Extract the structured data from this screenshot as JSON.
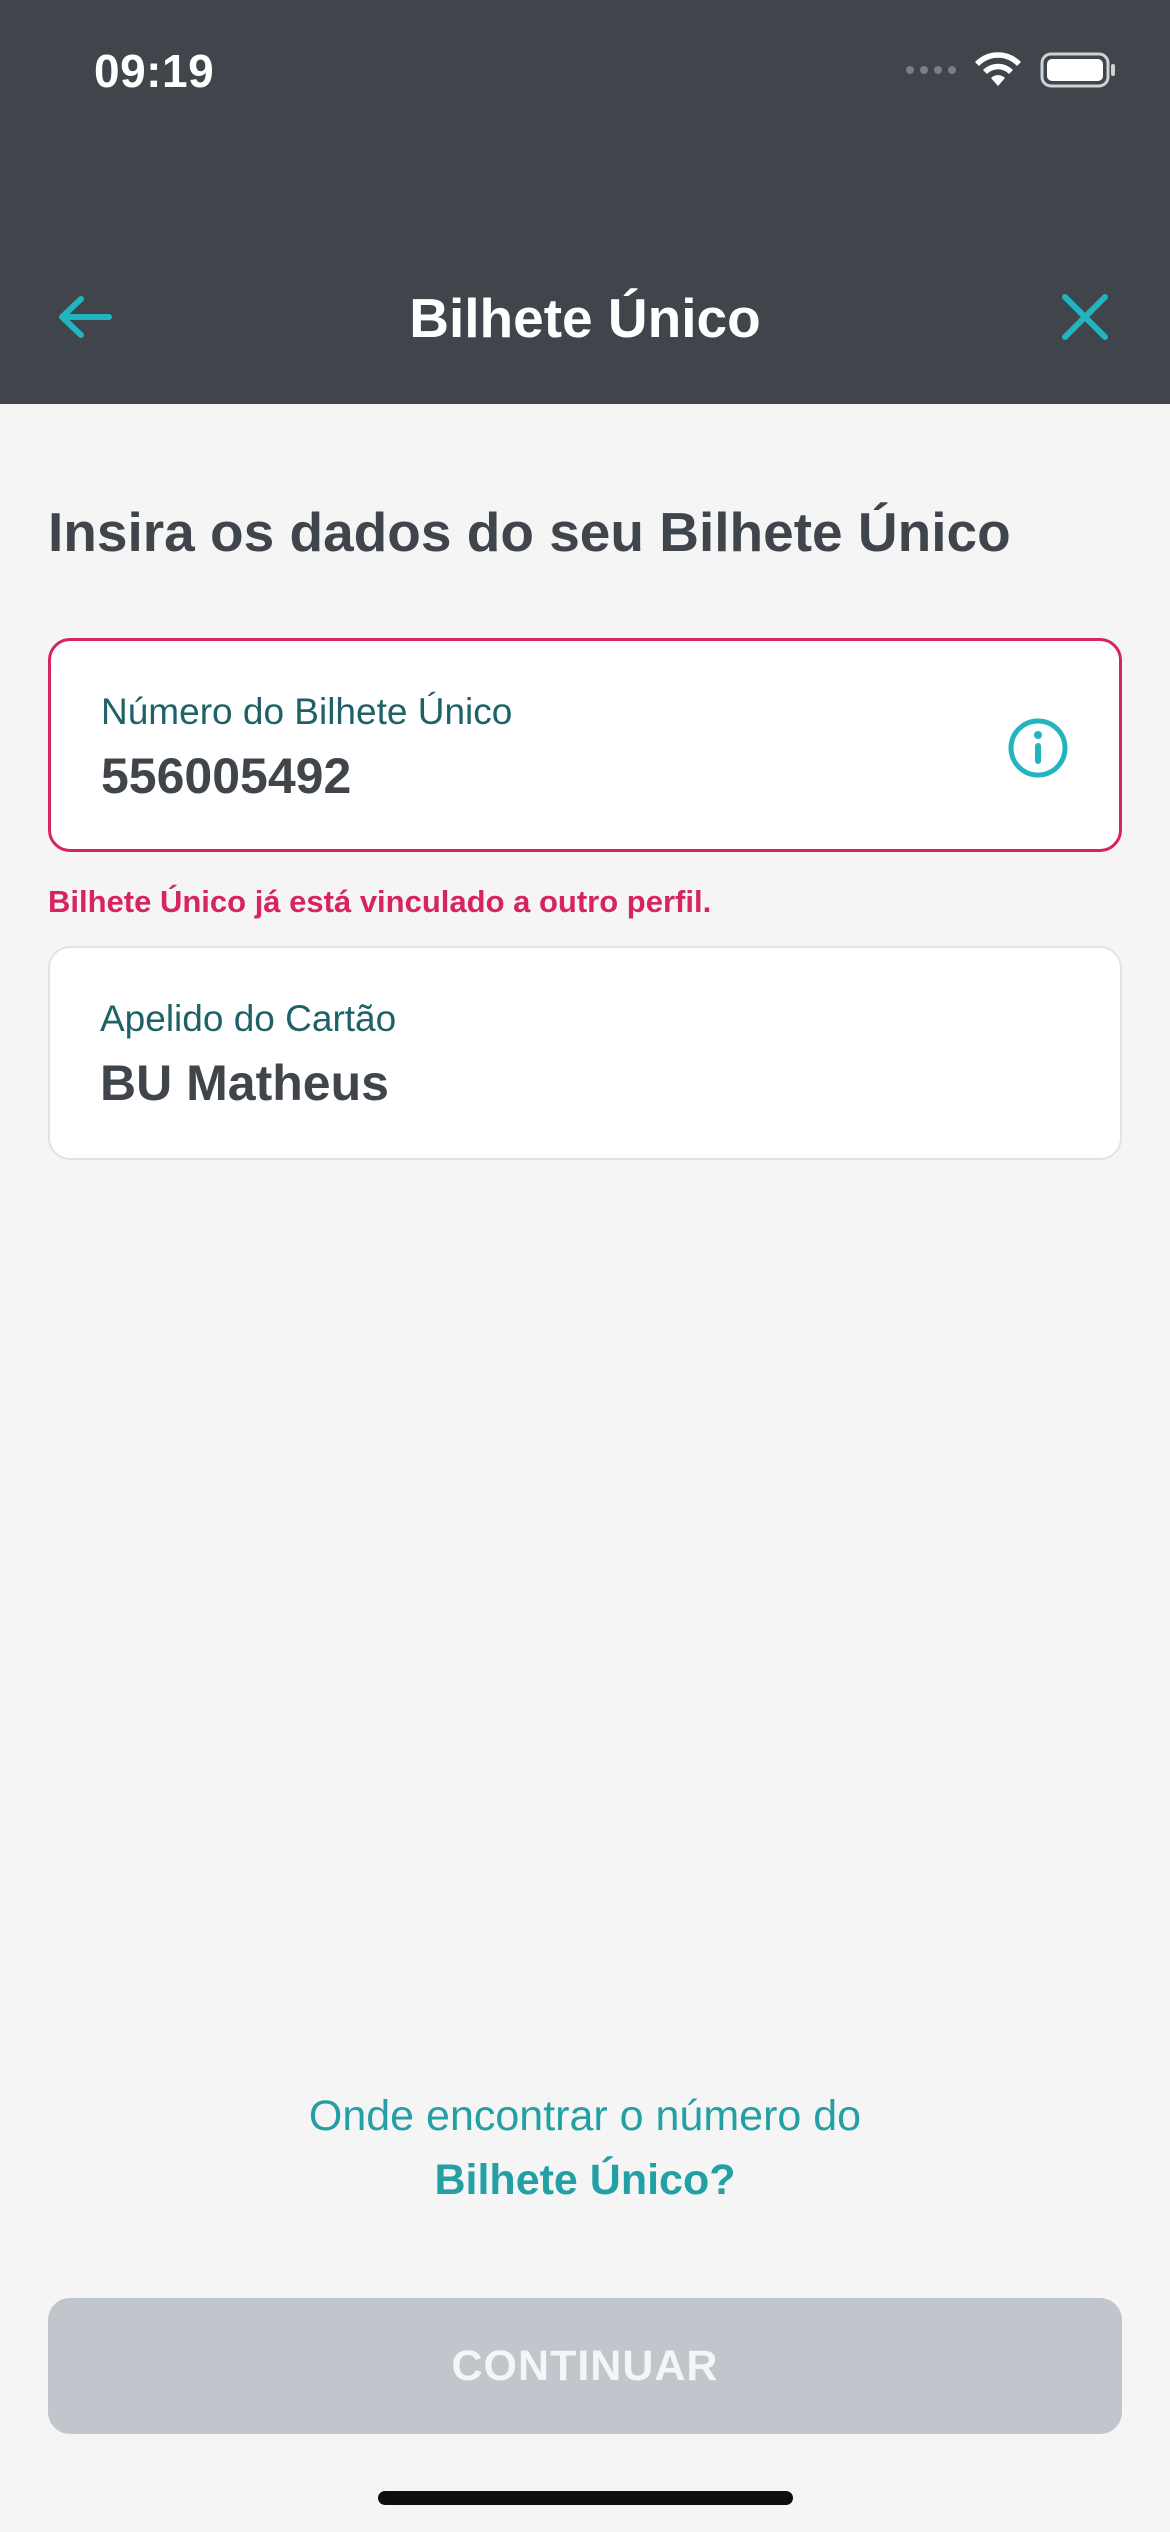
{
  "status_bar": {
    "time": "09:19"
  },
  "header": {
    "title": "Bilhete Único"
  },
  "page": {
    "heading": "Insira os dados do seu Bilhete Único"
  },
  "fields": {
    "card_number": {
      "label": "Número do Bilhete Único",
      "value": "556005492",
      "error": "Bilhete Único já está vinculado a outro perfil."
    },
    "card_nickname": {
      "label": "Apelido do Cartão",
      "value": "BU Matheus"
    }
  },
  "help_link": {
    "line1": "Onde encontrar o número do",
    "line2": "Bilhete Único?"
  },
  "continue_button": {
    "label": "CONTINUAR",
    "enabled": false
  },
  "colors": {
    "header_bg": "#3f454b",
    "accent": "#23a0a3",
    "error": "#d6245e",
    "disabled_button": "#c0c6cb"
  },
  "icons": [
    "arrow-left-icon",
    "close-icon",
    "info-icon",
    "wifi-icon",
    "battery-icon",
    "signal-icon"
  ]
}
